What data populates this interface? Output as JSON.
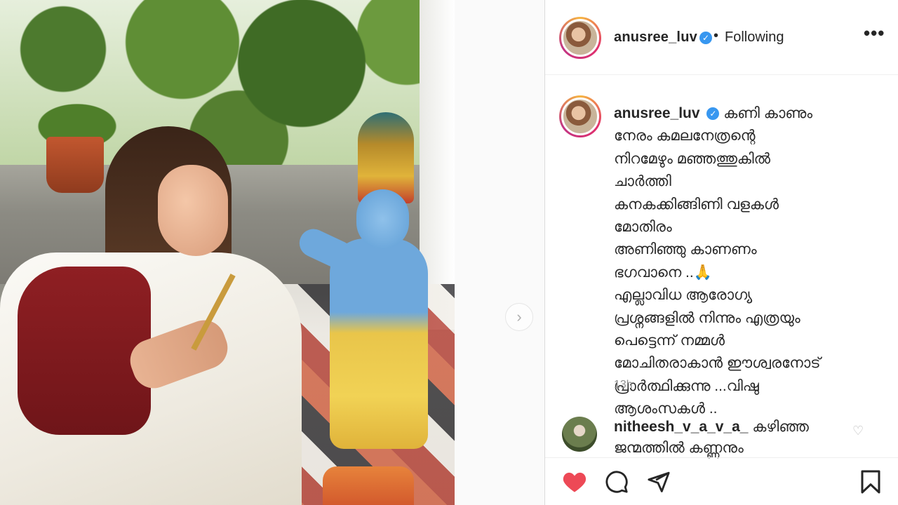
{
  "post": {
    "username": "anusree_luv",
    "verified": true,
    "dot": "•",
    "follow_status": "Following",
    "more_label": "•••"
  },
  "caption": {
    "username": "anusree_luv",
    "text": "കണി കാണും\nനേരം കമലനേത്രന്റെ\nനിറമേഴും മഞ്ഞത്തുകിൽ\nചാർത്തി\nകനകക്കിങ്ങിണി വളകൾ\nമോതിരം\nഅണിഞ്ഞു കാണണം\nഭഗവാനെ ..🙏\nഎല്ലാവിധ ആരോഗ്യ\nപ്രശ്നങ്ങളിൽ നിന്നും എത്രയും\nപെട്ടെന്ന് നമ്മൾ\nമോചിതരാകാൻ ഈശ്വരനോട്\nപ്രാർത്ഥിക്കുന്നു ...വിഷു\nആശംസകൾ ..",
    "time": "13h"
  },
  "comment": {
    "username": "nitheesh_v_a_v_a_",
    "text": "കഴിഞ്ഞ\nജന്മത്തിൽ കണ്ണനും"
  },
  "actions": {
    "like_icon": "heart-filled-icon",
    "comment_icon": "comment-bubble-icon",
    "share_icon": "paper-plane-icon",
    "save_icon": "bookmark-icon",
    "like_color": "#ed4956"
  },
  "carousel": {
    "next_icon": "chevron-right-icon",
    "next_glyph": "›"
  },
  "colors": {
    "verified": "#3897f0",
    "text": "#262626",
    "muted": "#8e8e8e"
  }
}
